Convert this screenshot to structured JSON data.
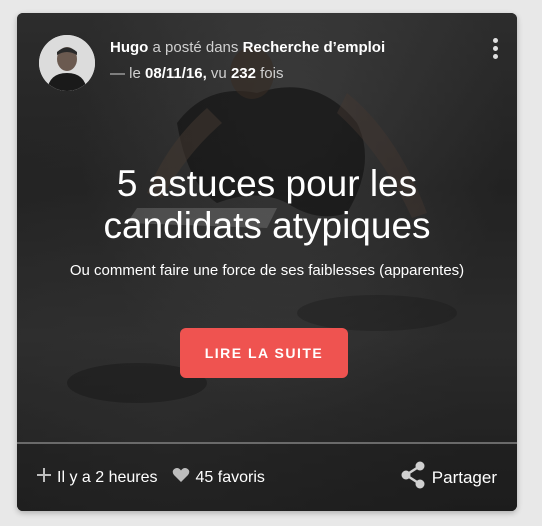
{
  "post": {
    "author": "Hugo",
    "posted_in_text": "a posté dans",
    "category": "Recherche d’emploi",
    "date_prefix": "— le",
    "date": "08/11/16,",
    "views_prefix": "vu",
    "views": "232",
    "views_suffix": "fois",
    "title": "5 astuces pour les candidats atypiques",
    "subtitle": "Ou comment faire une force de ses faiblesses (apparentes)",
    "cta_label": "LIRE LA SUITE"
  },
  "footer": {
    "time_label": "Il y a 2 heures",
    "favorites_label": "45 favoris",
    "share_label": "Partager"
  },
  "colors": {
    "cta": "#ef5350",
    "text": "#ffffff"
  },
  "icons": {
    "menu": "more-vertical-icon",
    "time": "plus-icon",
    "favorites": "heart-icon",
    "share": "share-icon"
  }
}
